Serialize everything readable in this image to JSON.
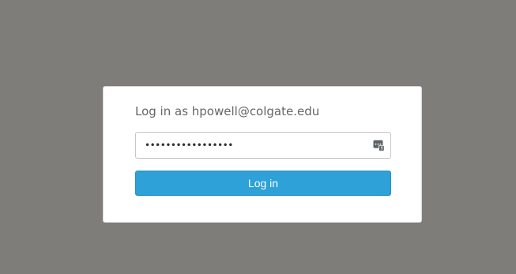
{
  "login": {
    "title": "Log in as hpowell@colgate.edu",
    "password_masked": "•••••••••••••••••",
    "button_label": "Log in"
  },
  "icons": {
    "password_manager": "password-manager-icon"
  },
  "colors": {
    "background": "#7e7d7a",
    "card": "#ffffff",
    "button": "#2da1d8",
    "title_text": "#666666"
  }
}
